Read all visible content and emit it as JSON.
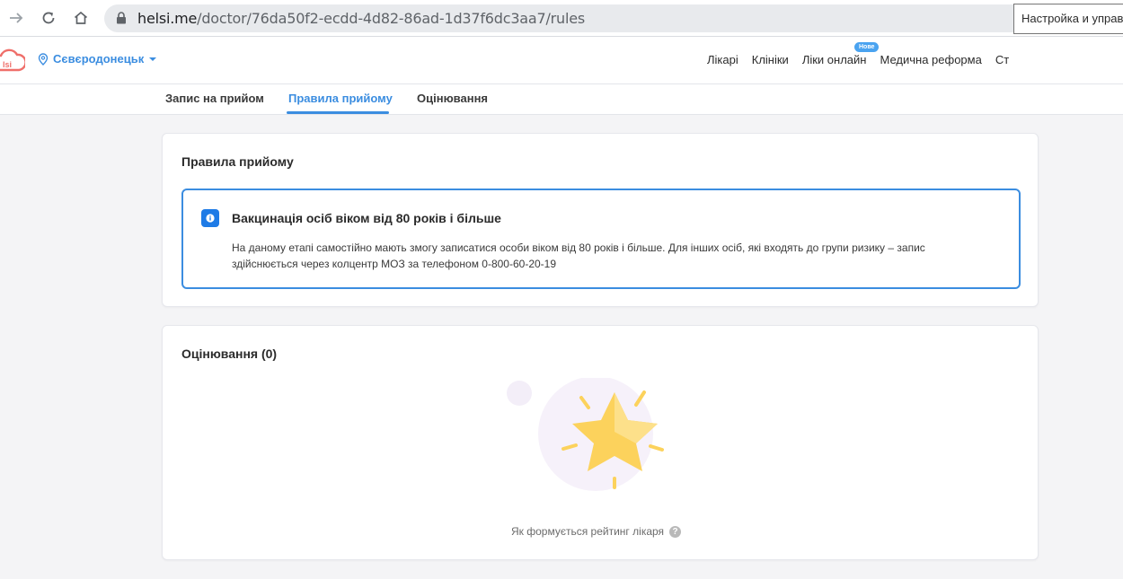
{
  "browser": {
    "url_host": "helsi.me",
    "url_path": "/doctor/76da50f2-ecdd-4d82-86ad-1d37f6dc3aa7/rules"
  },
  "header": {
    "city": "Сєвєродонецьк",
    "nav": [
      "Лікарі",
      "Клініки",
      "Ліки онлайн",
      "Медична реформа",
      "Ст"
    ],
    "new_badge": "Нове",
    "tooltip": "Настройка и управ"
  },
  "tabs": [
    {
      "label": "Запис на прийом",
      "active": false
    },
    {
      "label": "Правила прийому",
      "active": true
    },
    {
      "label": "Оцінювання",
      "active": false
    }
  ],
  "rules_card": {
    "title": "Правила прийому",
    "info_title": "Вакцинація осіб віком від 80 років і більше",
    "info_text": "На даному етапі самостійно мають змогу записатися особи віком від 80 років і більше. Для інших осіб, які входять до групи ризику – запис здійснюється через колцентр МОЗ за телефоном 0-800-60-20-19"
  },
  "rating_card": {
    "title": "Оцінювання (0)",
    "link": "Як формується рейтинг лікаря",
    "help_glyph": "?"
  },
  "colors": {
    "accent": "#3b8de0",
    "info_icon": "#1e7be6",
    "star": "#fcd25c",
    "background": "#f4f4f6"
  }
}
